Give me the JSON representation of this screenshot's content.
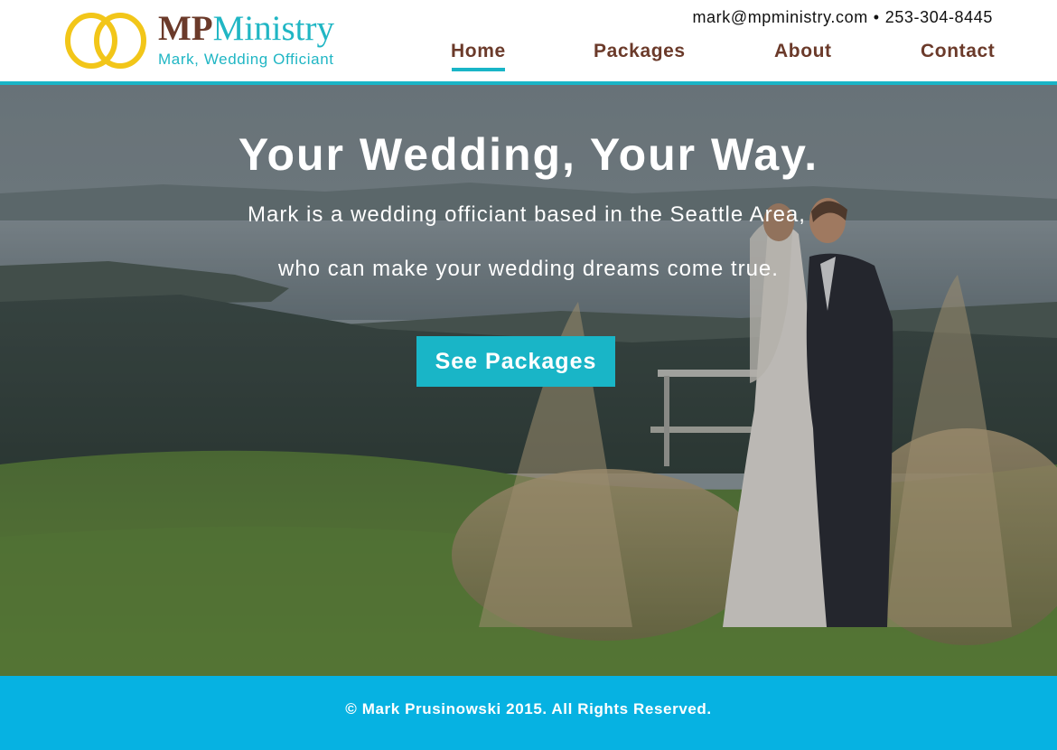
{
  "brand": {
    "name_mp": "MP",
    "name_ministry": "Ministry",
    "tagline": "Mark, Wedding Officiant",
    "icon": "wedding-rings-icon"
  },
  "contact": {
    "email": "mark@mpministry.com",
    "separator": "•",
    "phone": "253-304-8445"
  },
  "nav": {
    "items": [
      {
        "label": "Home",
        "active": true
      },
      {
        "label": "Packages",
        "active": false
      },
      {
        "label": "About",
        "active": false
      },
      {
        "label": "Contact",
        "active": false
      }
    ]
  },
  "hero": {
    "headline": "Your Wedding, Your Way.",
    "subline_1": "Mark is a wedding officiant based in the Seattle Area,",
    "subline_2": "who can make your wedding dreams come true.",
    "cta_label": "See Packages",
    "image": "wedding-couple-photo"
  },
  "footer": {
    "copyright": "© Mark Prusinowski 2015. All Rights Reserved."
  },
  "colors": {
    "brand_brown": "#6b3a2a",
    "accent_teal": "#19b5c7",
    "footer_blue": "#06b2e2",
    "ring_gold": "#f2c619"
  }
}
